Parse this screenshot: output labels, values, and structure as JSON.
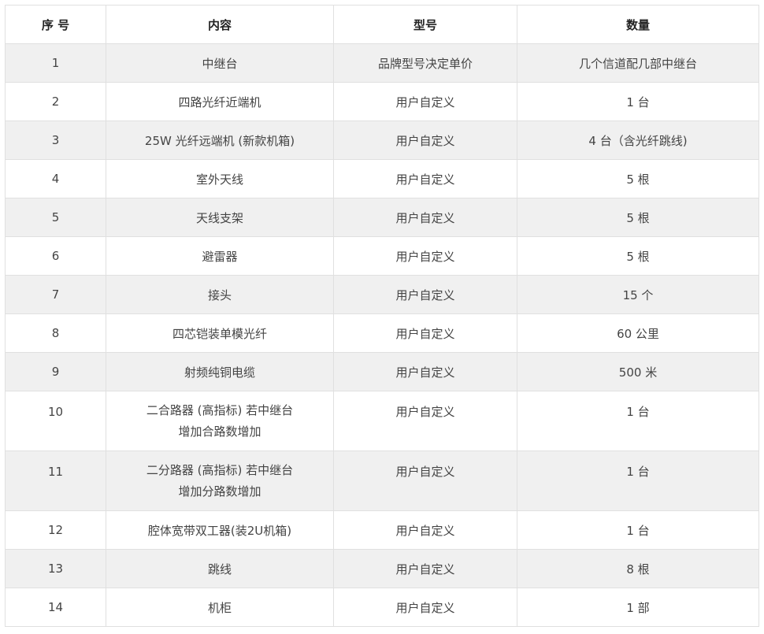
{
  "table": {
    "headers": [
      "序 号",
      "内容",
      "型号",
      "数量"
    ],
    "rows": [
      {
        "no": "1",
        "content": [
          "中继台"
        ],
        "model": "品牌型号决定单价",
        "qty": "几个信道配几部中继台"
      },
      {
        "no": "2",
        "content": [
          "四路光纤近端机"
        ],
        "model": "用户自定义",
        "qty": "1 台"
      },
      {
        "no": "3",
        "content": [
          "25W 光纤远端机 (新款机箱)"
        ],
        "model": "用户自定义",
        "qty": "4 台（含光纤跳线)"
      },
      {
        "no": "4",
        "content": [
          "室外天线"
        ],
        "model": "用户自定义",
        "qty": "5 根"
      },
      {
        "no": "5",
        "content": [
          "天线支架"
        ],
        "model": "用户自定义",
        "qty": "5 根"
      },
      {
        "no": "6",
        "content": [
          "避雷器"
        ],
        "model": "用户自定义",
        "qty": "5 根"
      },
      {
        "no": "7",
        "content": [
          "接头"
        ],
        "model": "用户自定义",
        "qty": "15 个"
      },
      {
        "no": "8",
        "content": [
          "四芯铠装单模光纤"
        ],
        "model": "用户自定义",
        "qty": "60 公里"
      },
      {
        "no": "9",
        "content": [
          "射频纯铜电缆"
        ],
        "model": "用户自定义",
        "qty": "500 米"
      },
      {
        "no": "10",
        "content": [
          "二合路器 (高指标) 若中继台",
          "增加合路数增加"
        ],
        "model": "用户自定义",
        "qty": "1 台"
      },
      {
        "no": "11",
        "content": [
          "二分路器 (高指标) 若中继台",
          "增加分路数增加"
        ],
        "model": "用户自定义",
        "qty": "1 台"
      },
      {
        "no": "12",
        "content": [
          "腔体宽带双工器(装2U机箱)"
        ],
        "model": "用户自定义",
        "qty": "1 台"
      },
      {
        "no": "13",
        "content": [
          "跳线"
        ],
        "model": "用户自定义",
        "qty": "8 根"
      },
      {
        "no": "14",
        "content": [
          "机柜"
        ],
        "model": "用户自定义",
        "qty": "1 部"
      }
    ]
  }
}
